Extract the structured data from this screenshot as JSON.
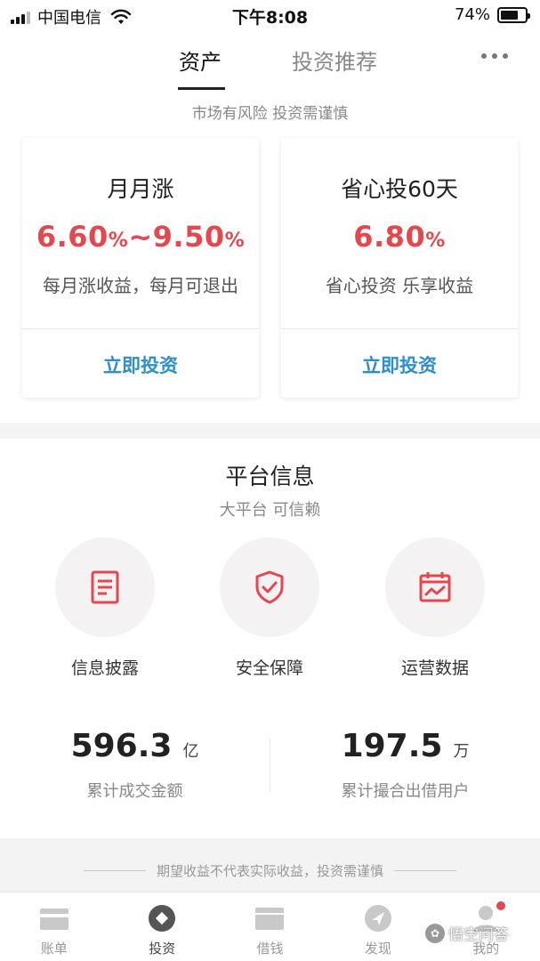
{
  "status_bar": {
    "carrier": "中国电信",
    "time": "下午8:08",
    "battery_percent": "74%",
    "battery_level": 0.74,
    "icons": [
      "signal-icon",
      "wifi-icon",
      "battery-icon"
    ]
  },
  "tabs": [
    {
      "label": "资产",
      "active": true
    },
    {
      "label": "投资推荐",
      "active": false
    }
  ],
  "risk_notice": "市场有风险 投资需谨慎",
  "products": [
    {
      "title": "月月涨",
      "rate_main": "6.60",
      "rate_pct1": "%",
      "rate_sep": "~",
      "rate_main2": "9.50",
      "rate_pct2": "%",
      "desc": "每月涨收益，每月可退出",
      "action": "立即投资"
    },
    {
      "title": "省心投60天",
      "rate_main": "6.80",
      "rate_pct": "%",
      "desc": "省心投资 乐享收益",
      "action": "立即投资"
    }
  ],
  "platform": {
    "title": "平台信息",
    "subtitle": "大平台 可信赖",
    "features": [
      {
        "label": "信息披露",
        "icon": "document-icon"
      },
      {
        "label": "安全保障",
        "icon": "shield-check-icon"
      },
      {
        "label": "运营数据",
        "icon": "calendar-chart-icon"
      }
    ],
    "stats": [
      {
        "value": "596.3",
        "unit": "亿",
        "label": "累计成交金额"
      },
      {
        "value": "197.5",
        "unit": "万",
        "label": "累计撮合出借用户"
      }
    ]
  },
  "disclaimer": "期望收益不代表实际收益，投资需谨慎",
  "bottom_nav": [
    {
      "label": "账单",
      "icon": "bill-icon",
      "active": false
    },
    {
      "label": "投资",
      "icon": "invest-icon",
      "active": true
    },
    {
      "label": "借钱",
      "icon": "wallet-icon",
      "active": false
    },
    {
      "label": "发现",
      "icon": "compass-icon",
      "active": false
    },
    {
      "label": "我的",
      "icon": "user-icon",
      "active": false,
      "badge": true
    }
  ],
  "watermark": {
    "text": "悟空问答"
  },
  "colors": {
    "accent_red": "#e4484f",
    "link_blue": "#2f8fcb",
    "text_dark": "#222222",
    "text_gray": "#888888"
  }
}
